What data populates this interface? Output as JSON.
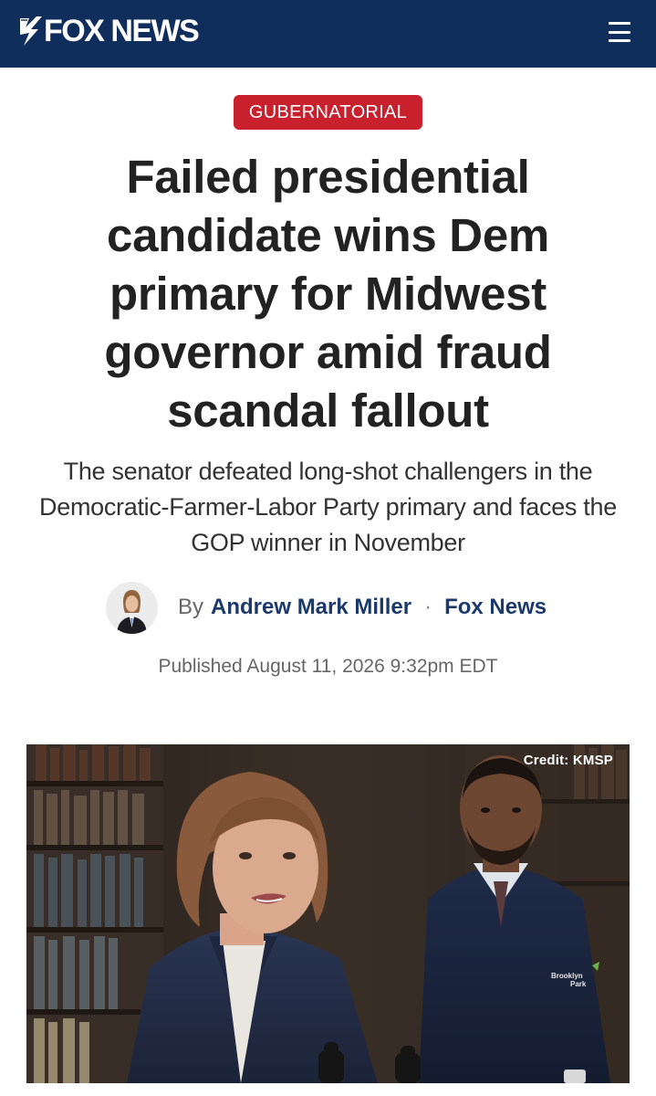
{
  "header": {
    "logo_text": "FOX NEWS",
    "bg_color": "#0f2e5c",
    "menu_icon": "hamburger-menu-icon"
  },
  "article": {
    "category": "GUBERNATORIAL",
    "category_color": "#c8202c",
    "headline": "Failed presidential candidate wins Dem primary for Midwest governor amid fraud scandal fallout",
    "subheadline": "The senator defeated long-shot challengers in the Democratic-Farmer-Labor Party primary and faces the GOP winner in November",
    "byline": {
      "by_label": "By",
      "author": "Andrew Mark Miller",
      "separator": "·",
      "outlet": "Fox News"
    },
    "published": "Published August 11, 2026 9:32pm EDT",
    "hero_image": {
      "credit": "Credit: KMSP",
      "sign_text": "Brooklyn Park"
    }
  }
}
